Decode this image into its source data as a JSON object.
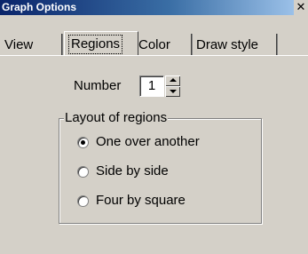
{
  "window": {
    "title": "Graph Options",
    "close_glyph": "✕"
  },
  "tabs": [
    {
      "label": "View",
      "selected": false
    },
    {
      "label": "Regions",
      "selected": true
    },
    {
      "label": "Color",
      "selected": false
    },
    {
      "label": "Draw style",
      "selected": false
    }
  ],
  "number": {
    "label": "Number",
    "value": "1"
  },
  "layout_group": {
    "title": "Layout of regions",
    "options": [
      {
        "label": "One over another",
        "selected": true
      },
      {
        "label": "Side by side",
        "selected": false
      },
      {
        "label": "Four by square",
        "selected": false
      }
    ]
  },
  "colors": {
    "face": "#d4d0c8",
    "title_start": "#0a246a",
    "title_end": "#a6caf0"
  }
}
